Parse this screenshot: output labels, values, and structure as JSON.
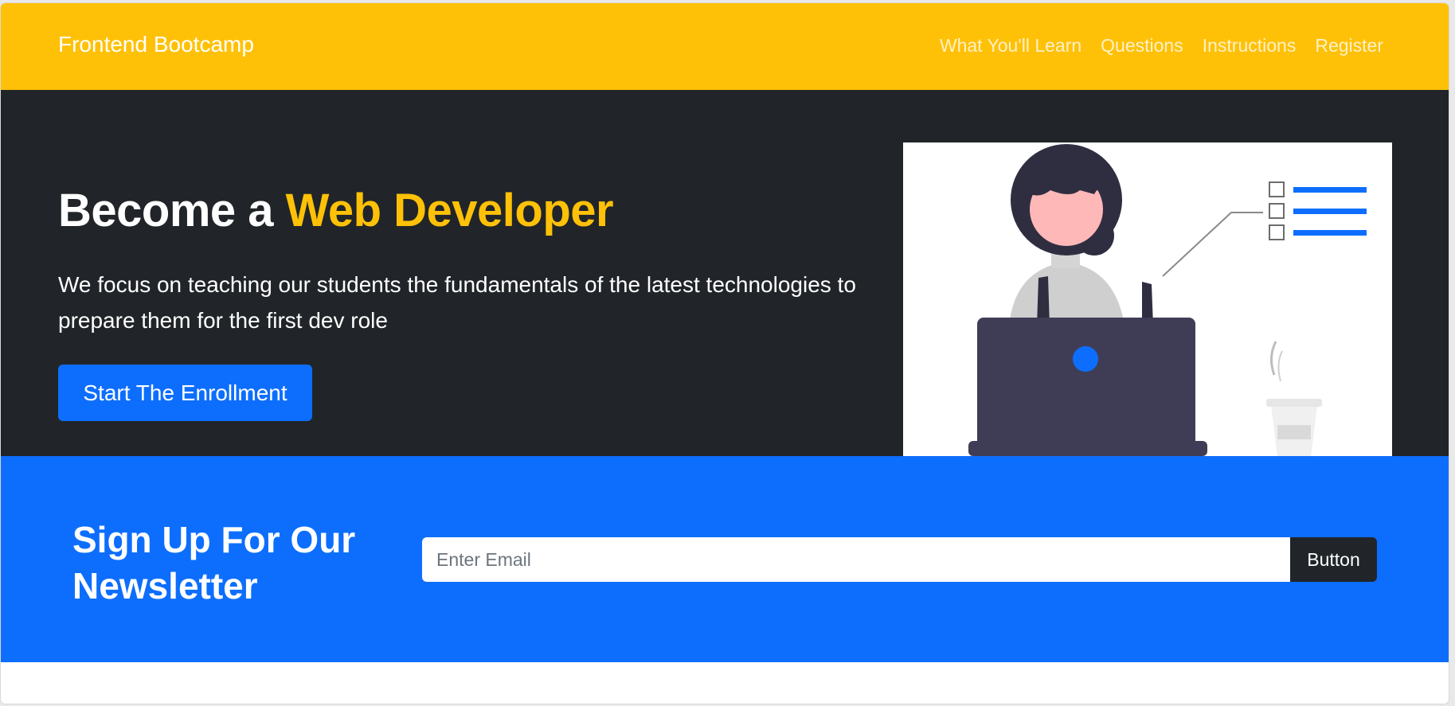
{
  "navbar": {
    "brand": "Frontend Bootcamp",
    "links": [
      "What You'll Learn",
      "Questions",
      "Instructions",
      "Register"
    ]
  },
  "hero": {
    "title_prefix": "Become a ",
    "title_accent": "Web Developer",
    "lead": "We focus on teaching our students the fundamentals of the latest technologies to prepare them for the first dev role",
    "button_label": "Start The Enrollment",
    "illustration_icon": "woman-at-laptop-illustration"
  },
  "newsletter": {
    "title": "Sign Up For Our Newsletter",
    "email_placeholder": "Enter Email",
    "email_value": "",
    "button_label": "Button"
  },
  "colors": {
    "warning": "#ffc107",
    "dark": "#212529",
    "primary": "#0d6efd",
    "illustration_dark": "#3f3d56",
    "illustration_skin": "#ffb8b8",
    "illustration_gray": "#cfcfcf"
  }
}
